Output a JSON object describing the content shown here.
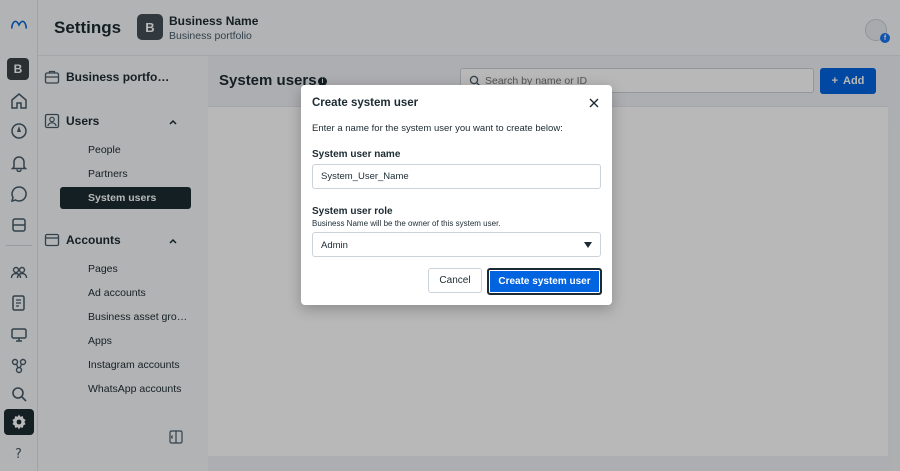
{
  "header": {
    "title": "Settings",
    "business_initial": "B",
    "business_name": "Business Name",
    "business_subtitle": "Business portfolio"
  },
  "rail": {
    "avatar_initial": "B",
    "icons": [
      "meta-logo-icon",
      "home-icon",
      "compass-icon",
      "bell-icon",
      "chat-icon",
      "stack-icon",
      "people-icon",
      "document-icon",
      "monitor-icon",
      "flow-icon",
      "search-icon",
      "gear-icon",
      "help-icon"
    ]
  },
  "sidebar": {
    "portfolio_label": "Business portfo…",
    "users_header": "Users",
    "users_items": [
      "People",
      "Partners",
      "System users"
    ],
    "accounts_header": "Accounts",
    "accounts_items": [
      "Pages",
      "Ad accounts",
      "Business asset gro…",
      "Apps",
      "Instagram accounts",
      "WhatsApp accounts"
    ]
  },
  "main": {
    "title": "System users",
    "search_placeholder": "Search by name or ID",
    "add_label": "Add"
  },
  "modal": {
    "title": "Create system user",
    "description": "Enter a name for the system user you want to create below:",
    "name_label": "System user name",
    "name_value": "System_User_Name",
    "role_label": "System user role",
    "role_hint": "Business Name will be the owner of this system user.",
    "role_value": "Admin",
    "cancel_label": "Cancel",
    "create_label": "Create system user"
  },
  "colors": {
    "primary": "#0064e0",
    "dark": "#1c2b33"
  }
}
